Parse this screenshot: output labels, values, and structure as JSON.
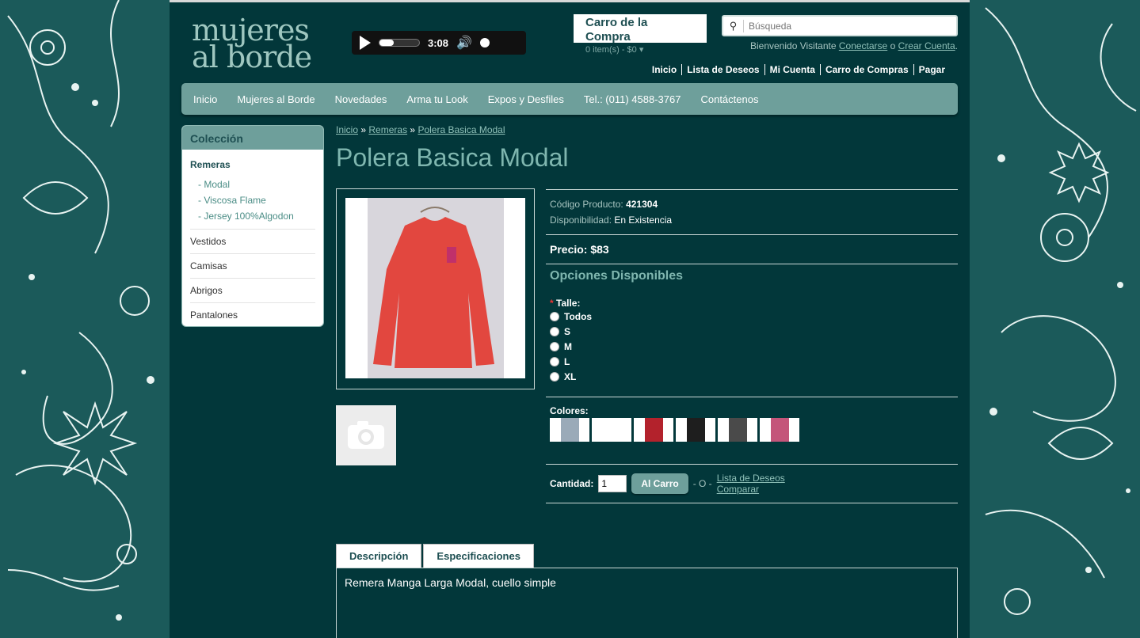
{
  "header": {
    "logo": "mujeres al borde",
    "player": {
      "time": "3:08",
      "progress": 0.35
    },
    "cart": {
      "title": "Carro de la Compra",
      "summary": "0 item(s) - $0"
    },
    "search_placeholder": "Búsqueda",
    "welcome": {
      "prefix": "Bienvenido Visitante",
      "login": "Conectarse",
      "or": "o",
      "register": "Crear Cuenta"
    },
    "toplinks": [
      "Inicio",
      "Lista de Deseos",
      "Mi Cuenta",
      "Carro de Compras",
      "Pagar"
    ]
  },
  "nav": [
    "Inicio",
    "Mujeres al Borde",
    "Novedades",
    "Arma tu Look",
    "Expos y Desfiles",
    "Tel.: (011) 4588-3767",
    "Contáctenos"
  ],
  "sidebar": {
    "title": "Colección",
    "current": "Remeras",
    "subs": [
      "- Modal",
      "- Viscosa Flame",
      "- Jersey 100%Algodon"
    ],
    "cats": [
      "Vestidos",
      "Camisas",
      "Abrigos",
      "Pantalones"
    ]
  },
  "breadcrumb": {
    "home": "Inicio",
    "sep": "»",
    "cat": "Remeras",
    "product": "Polera Basica Modal"
  },
  "product": {
    "title": "Polera Basica Modal",
    "code_label": "Código Producto:",
    "code": "421304",
    "avail_label": "Disponibilidad:",
    "avail": "En Existencia",
    "price": "Precio: $83",
    "options_head": "Opciones Disponibles",
    "size_label": "Talle:",
    "sizes": [
      "Todos",
      "S",
      "M",
      "L",
      "XL"
    ],
    "colors_label": "Colores:",
    "colors": [
      "#9aaab8",
      "#ffffff",
      "#b3222c",
      "#1e1e1e",
      "#4a4a4a",
      "#c4557a"
    ],
    "qty_label": "Cantidad:",
    "qty": "1",
    "cart_button": "Al Carro",
    "or": "- O -",
    "wishlist": "Lista de Deseos",
    "compare": "Comparar"
  },
  "tabs": [
    "Descripción",
    "Especificaciones"
  ],
  "description": "Remera Manga Larga Modal, cuello simple"
}
